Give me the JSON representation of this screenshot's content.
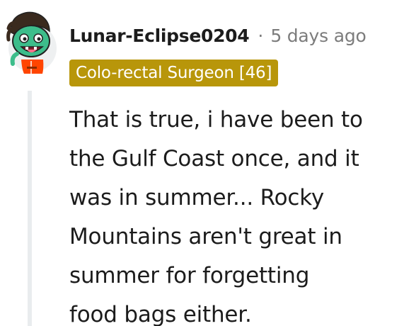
{
  "comment": {
    "username": "Lunar-Eclipse0204",
    "separator": "·",
    "timestamp": "5 days ago",
    "flair": "Colo-rectal Surgeon [46]",
    "body_lines": [
      "That is true, i have been to",
      "the Gulf Coast once, and it",
      "was in summer... Rocky",
      "Mountains aren't great in",
      "summer for forgetting",
      "food bags either."
    ]
  },
  "colors": {
    "flair_background": "#b8960a",
    "username_text": "#1c1c1c",
    "meta_text": "#7c7c7c",
    "thread_line": "#e9ecee"
  },
  "icons": {
    "avatar": "snoo-avatar-icon"
  }
}
